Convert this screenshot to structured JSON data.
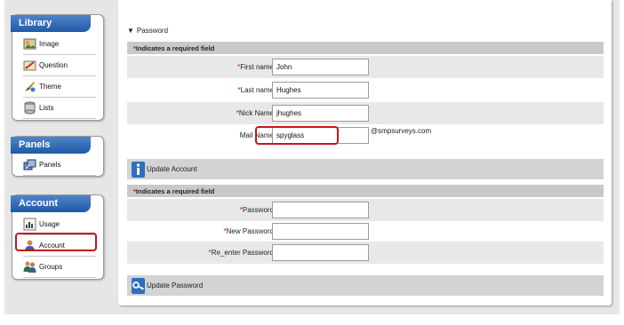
{
  "sidebar": {
    "library": {
      "title": "Library",
      "items": [
        {
          "label": "Image",
          "icon": "image-icon"
        },
        {
          "label": "Question",
          "icon": "question-icon"
        },
        {
          "label": "Theme",
          "icon": "theme-icon"
        },
        {
          "label": "Lists",
          "icon": "lists-icon"
        }
      ]
    },
    "panels": {
      "title": "Panels",
      "items": [
        {
          "label": "Panels",
          "icon": "panels-icon"
        }
      ]
    },
    "account": {
      "title": "Account",
      "items": [
        {
          "label": "Usage",
          "icon": "usage-icon"
        },
        {
          "label": "Account",
          "icon": "account-icon"
        },
        {
          "label": "Groups",
          "icon": "groups-icon"
        }
      ]
    }
  },
  "form": {
    "section_toggle": "Password",
    "required_note": "Indicates a required field",
    "account_fields": {
      "first_name": {
        "label": "First name",
        "value": "John"
      },
      "last_name": {
        "label": "Last name",
        "value": "Hughes"
      },
      "nick_name": {
        "label": "Nick Name",
        "value": "jhughes"
      },
      "mail_name": {
        "label": "Mail Name",
        "value": "spyglass",
        "suffix": "@smpsurveys.com"
      }
    },
    "update_account_label": "Update Account",
    "password_fields": {
      "password": {
        "label": "Password",
        "value": ""
      },
      "new_password": {
        "label": "New Password",
        "value": ""
      },
      "reenter_password": {
        "label": "Re_enter Password",
        "value": ""
      }
    },
    "update_password_label": "Update Password"
  },
  "colors": {
    "header_blue": "#1f5aa6",
    "highlight_red": "#c8141e",
    "required_star": "#c81414"
  }
}
